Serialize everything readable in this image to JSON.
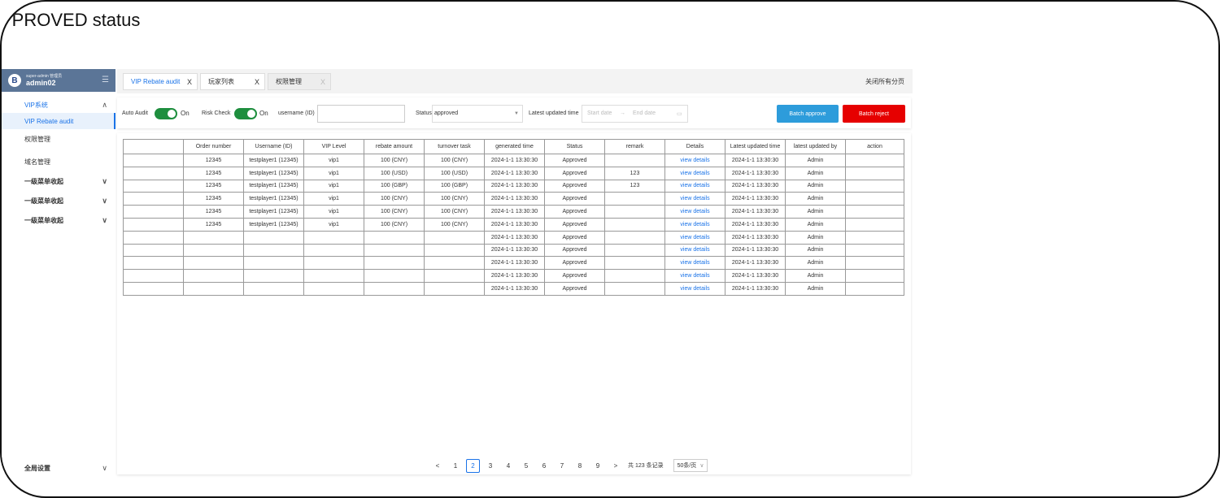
{
  "frame_title": "PPROVED status",
  "user": {
    "avatar_letter": "B",
    "role": "super-admin 管理员",
    "name": "admin02"
  },
  "sidebar": {
    "menu_icon": "menu-icon",
    "items": [
      {
        "label": "VIP系统",
        "state": "open-group"
      },
      {
        "label": "VIP Rebate audit",
        "state": "active"
      },
      {
        "label": "权限管理",
        "state": "normal"
      },
      {
        "label": "域名管理",
        "state": "normal"
      },
      {
        "label": "一级菜单收起",
        "state": "collapsed"
      },
      {
        "label": "一级菜单收起",
        "state": "collapsed"
      },
      {
        "label": "一级菜单收起",
        "state": "collapsed"
      }
    ],
    "global_settings": "全局设置"
  },
  "tabs": [
    {
      "label": "VIP Rebate audit",
      "close": "X"
    },
    {
      "label": "玩家列表",
      "close": "X"
    },
    {
      "label": "权限管理",
      "close": "X"
    }
  ],
  "close_all": "关闭所有分页",
  "filters": {
    "auto_audit_label": "Auto Audit",
    "auto_audit_state": "On",
    "risk_check_label": "Risk Check",
    "risk_check_state": "On",
    "username_label": "username (ID)",
    "username_value": "",
    "status_label": "Status",
    "status_value": "approved",
    "latest_updated_label": "Latest updated time",
    "start_date_placeholder": "Start date",
    "date_arrow": "→",
    "end_date_placeholder": "End date",
    "batch_approve": "Batch approve",
    "batch_reject": "Batch reject",
    "colors": {
      "switch_on": "#1e8e3e",
      "approve": "#2d9cdb",
      "reject": "#e60000",
      "accent": "#1a73e8"
    }
  },
  "table": {
    "headers": [
      "",
      "Order number",
      "Username (ID)",
      "VIP Level",
      "rebate amount",
      "turnover task",
      "generated time",
      "Status",
      "remark",
      "Details",
      "Latest updated time",
      "latest updated by",
      "action"
    ],
    "rows": [
      [
        "",
        "12345",
        "testplayer1 (12345)",
        "vip1",
        "100 (CNY)",
        "100 (CNY)",
        "2024-1-1 13:30:30",
        "Approved",
        "",
        "view details",
        "2024-1-1 13:30:30",
        "Admin",
        ""
      ],
      [
        "",
        "12345",
        "testplayer1 (12345)",
        "vip1",
        "100 (USD)",
        "100 (USD)",
        "2024-1-1 13:30:30",
        "Approved",
        "123",
        "view details",
        "2024-1-1 13:30:30",
        "Admin",
        ""
      ],
      [
        "",
        "12345",
        "testplayer1 (12345)",
        "vip1",
        "100 (GBP)",
        "100 (GBP)",
        "2024-1-1 13:30:30",
        "Approved",
        "123",
        "view details",
        "2024-1-1 13:30:30",
        "Admin",
        ""
      ],
      [
        "",
        "12345",
        "testplayer1 (12345)",
        "vip1",
        "100 (CNY)",
        "100 (CNY)",
        "2024-1-1 13:30:30",
        "Approved",
        "",
        "view details",
        "2024-1-1 13:30:30",
        "Admin",
        ""
      ],
      [
        "",
        "12345",
        "testplayer1 (12345)",
        "vip1",
        "100 (CNY)",
        "100 (CNY)",
        "2024-1-1 13:30:30",
        "Approved",
        "",
        "view details",
        "2024-1-1 13:30:30",
        "Admin",
        ""
      ],
      [
        "",
        "12345",
        "testplayer1 (12345)",
        "vip1",
        "100 (CNY)",
        "100 (CNY)",
        "2024-1-1 13:30:30",
        "Approved",
        "",
        "view details",
        "2024-1-1 13:30:30",
        "Admin",
        ""
      ],
      [
        "",
        "",
        "",
        "",
        "",
        "",
        "2024-1-1 13:30:30",
        "Approved",
        "",
        "view details",
        "2024-1-1 13:30:30",
        "Admin",
        ""
      ],
      [
        "",
        "",
        "",
        "",
        "",
        "",
        "2024-1-1 13:30:30",
        "Approved",
        "",
        "view details",
        "2024-1-1 13:30:30",
        "Admin",
        ""
      ],
      [
        "",
        "",
        "",
        "",
        "",
        "",
        "2024-1-1 13:30:30",
        "Approved",
        "",
        "view details",
        "2024-1-1 13:30:30",
        "Admin",
        ""
      ],
      [
        "",
        "",
        "",
        "",
        "",
        "",
        "2024-1-1 13:30:30",
        "Approved",
        "",
        "view details",
        "2024-1-1 13:30:30",
        "Admin",
        ""
      ],
      [
        "",
        "",
        "",
        "",
        "",
        "",
        "2024-1-1 13:30:30",
        "Approved",
        "",
        "view details",
        "2024-1-1 13:30:30",
        "Admin",
        ""
      ]
    ]
  },
  "pagination": {
    "prev": "<",
    "pages": [
      "1",
      "2",
      "3",
      "4",
      "5",
      "6",
      "7",
      "8",
      "9"
    ],
    "current": "2",
    "next": ">",
    "total": "共 123 条记录",
    "page_size": "50条/页"
  }
}
